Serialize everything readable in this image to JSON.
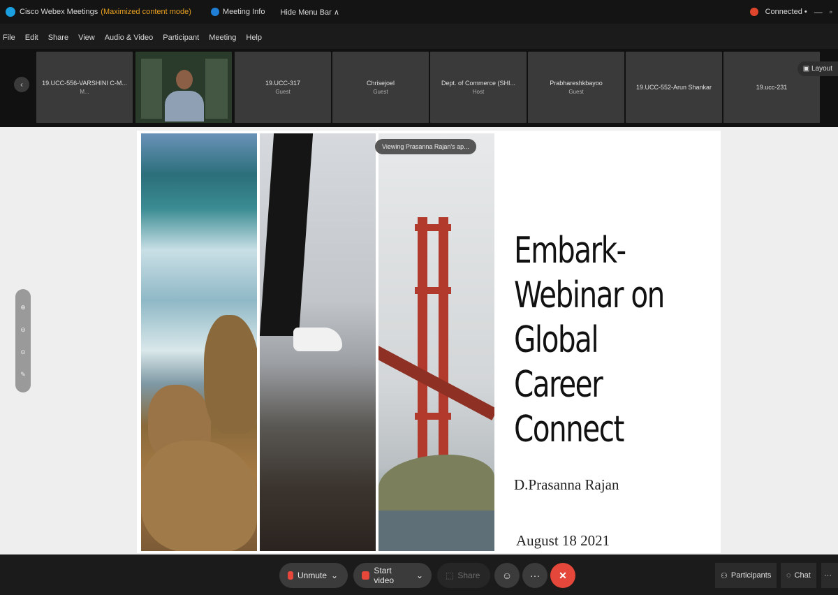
{
  "titlebar": {
    "app_title": "Cisco Webex Meetings",
    "mode": "(Maximized content mode)",
    "meeting_info": "Meeting Info",
    "hide_menu": "Hide Menu Bar ∧",
    "connection": "Connected •",
    "min": "—",
    "restore": "▫"
  },
  "menu": [
    "File",
    "Edit",
    "Share",
    "View",
    "Audio & Video",
    "Participant",
    "Meeting",
    "Help"
  ],
  "participants": [
    {
      "name": "19.UCC-556-VARSHINI C-M...",
      "sub": "M..."
    },
    {
      "name": "",
      "sub": ""
    },
    {
      "name": "19.UCC-317",
      "sub": "Guest"
    },
    {
      "name": "Chrisejoel",
      "sub": "Guest"
    },
    {
      "name": "Dept. of Commerce (SHI...",
      "sub": "Host"
    },
    {
      "name": "Prabhareshkbayoo",
      "sub": "Guest"
    },
    {
      "name": "19.UCC-552-Arun Shankar",
      "sub": ""
    },
    {
      "name": "19.ucc-231",
      "sub": ""
    }
  ],
  "layout_label": "Layout",
  "viewing_pill": "Viewing Prasanna Rajan's ap...",
  "slide": {
    "title": "Embark-Webinar on Global Career Connect",
    "author": "D.Prasanna Rajan",
    "date": "August 18 2021"
  },
  "controls": {
    "unmute": "Unmute",
    "start_video": "Start video",
    "share": "Share",
    "participants": "Participants",
    "chat": "Chat",
    "more": "···"
  },
  "colors": {
    "accent_red": "#e5483a",
    "mode_orange": "#e8a020",
    "webex_blue": "#1aa0e0"
  }
}
